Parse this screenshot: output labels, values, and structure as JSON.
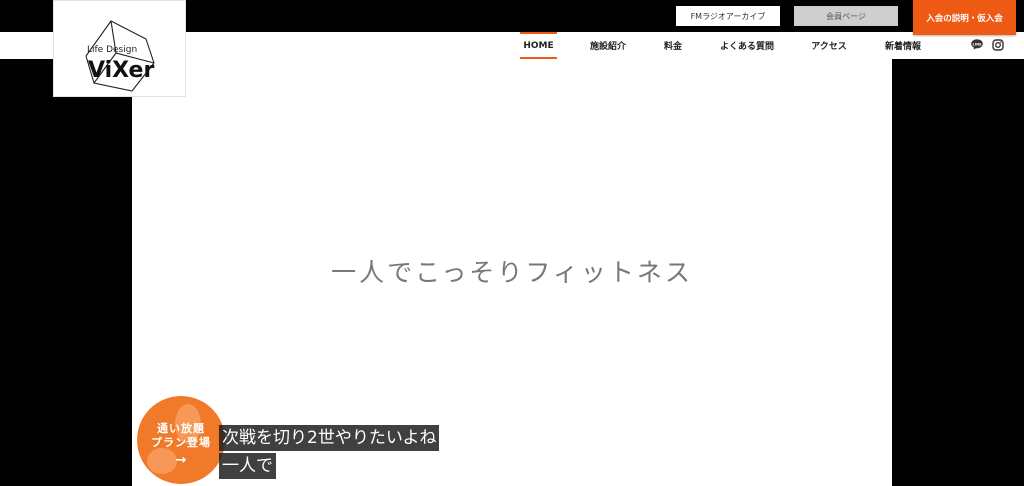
{
  "header": {
    "buttons": {
      "radio_archive": "FMラジオアーカイブ",
      "member_page": "会員ページ",
      "join": "入会の説明・仮入会"
    },
    "logo": {
      "line1": "Life Design",
      "line2": "ViXer"
    },
    "nav": [
      {
        "label": "HOME",
        "active": true
      },
      {
        "label": "施設紹介",
        "active": false
      },
      {
        "label": "料金",
        "active": false
      },
      {
        "label": "よくある質問",
        "active": false
      },
      {
        "label": "アクセス",
        "active": false
      },
      {
        "label": "新着情報",
        "active": false
      }
    ],
    "social": [
      "line-icon",
      "instagram-icon"
    ]
  },
  "hero": {
    "headline": "一人でこっそりフィットネス"
  },
  "badge": {
    "line1": "通い放題",
    "line2": "プラン登場",
    "arrow": "→"
  },
  "caption": {
    "line1": "次戦を切り2世やりたいよね",
    "line2": "一人で"
  },
  "colors": {
    "accent": "#ee5a14",
    "badge": "#f07a2a"
  }
}
